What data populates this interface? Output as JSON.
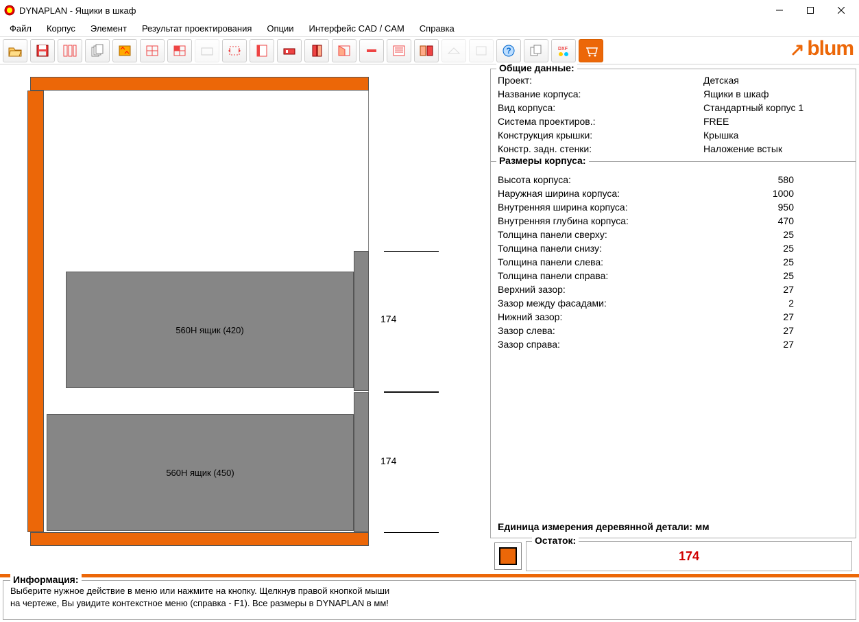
{
  "app": {
    "title": "DYNAPLAN - Ящики в шкаф"
  },
  "menu": {
    "file": "Файл",
    "corpus": "Корпус",
    "element": "Элемент",
    "design_result": "Результат проектирования",
    "options": "Опции",
    "cadcam": "Интерфейс CAD / CAM",
    "help": "Справка"
  },
  "brand": "blum",
  "toolbar": {
    "open": "open",
    "save": "save",
    "props": "props",
    "multi": "multi",
    "newpanel": "new",
    "grid1": "grid1",
    "grid2": "grid2",
    "drawer_el": "drawer",
    "rotate": "rotate",
    "side": "side",
    "front": "front",
    "door": "door",
    "door2": "door2",
    "minus": "minus",
    "list": "list",
    "cabinets": "cabinets",
    "plane": "plane",
    "spacer": "spacer",
    "help": "help",
    "copy": "copy",
    "dxf": "dxf",
    "shop": "shop"
  },
  "drawing": {
    "drawer1_label": "560H ящик (420)",
    "drawer2_label": "560H ящик (450)",
    "dim1": "174",
    "dim2": "174"
  },
  "general": {
    "panel_title": "Общие данные:",
    "project_k": "Проект:",
    "project_v": "Детская",
    "name_k": "Название корпуса:",
    "name_v": "Ящики в шкаф",
    "type_k": "Вид корпуса:",
    "type_v": "Стандартный корпус 1",
    "system_k": "Система проектиров.:",
    "system_v": "FREE",
    "lid_k": "Конструкция крышки:",
    "lid_v": "Крышка",
    "back_k": "Констр. задн. стенки:",
    "back_v": "Наложение встык"
  },
  "sizes": {
    "panel_title": "Размеры корпуса:",
    "rows": [
      {
        "k": "Высота корпуса:",
        "v": "580"
      },
      {
        "k": "Наружная ширина корпуса:",
        "v": "1000"
      },
      {
        "k": "Внутренняя ширина корпуса:",
        "v": "950"
      },
      {
        "k": "Внутренняя глубина корпуса:",
        "v": "470"
      },
      {
        "k": "Толщина панели сверху:",
        "v": "25"
      },
      {
        "k": "Толщина панели снизу:",
        "v": "25"
      },
      {
        "k": "Толщина панели слева:",
        "v": "25"
      },
      {
        "k": "Толщина панели справа:",
        "v": "25"
      },
      {
        "k": "Верхний зазор:",
        "v": "27"
      },
      {
        "k": "Зазор между фасадами:",
        "v": "2"
      },
      {
        "k": "Нижний зазор:",
        "v": "27"
      },
      {
        "k": "Зазор слева:",
        "v": "27"
      },
      {
        "k": "Зазор справа:",
        "v": "27"
      }
    ],
    "unit_note": "Единица измерения деревянной детали: мм"
  },
  "remainder": {
    "label": "Остаток:",
    "value": "174"
  },
  "info": {
    "title": "Информация:",
    "line1": "Выберите нужное действие в меню или нажмите на кнопку. Щелкнув правой кнопкой мыши",
    "line2": "на чертеже, Вы увидите контекстное меню (справка - F1). Все размеры в DYNAPLAN в мм!"
  }
}
